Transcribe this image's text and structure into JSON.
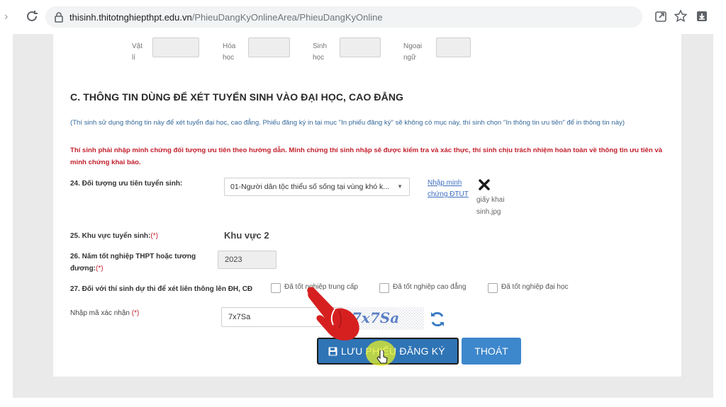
{
  "browser": {
    "url_host": "thisinh.thitotnghiepthpt.edu.vn",
    "url_path": "/PhieuDangKyOnlineArea/PhieuDangKyOnline"
  },
  "scores_row": {
    "subjects": [
      {
        "line1": "Vật",
        "line2": "lí"
      },
      {
        "line1": "Hóa",
        "line2": "học"
      },
      {
        "line1": "Sinh",
        "line2": "học"
      },
      {
        "line1": "Ngoại",
        "line2": "ngữ"
      }
    ]
  },
  "section_c": {
    "title": "C. THÔNG TIN DÙNG ĐỂ XÉT TUYỂN SINH VÀO ĐẠI HỌC, CAO ĐẲNG",
    "note_info": "(Thí sinh sử dụng thông tin này để xét tuyển đại học, cao đẳng. Phiếu đăng ký in tại mục \"In phiếu đăng ký\" sẽ không có mục này, thí sinh chọn \"In thông tin ưu tiên\" để in thông tin này)",
    "note_warning": "Thí sinh phải nhập minh chứng đối tượng ưu tiên theo hướng dẫn. Minh chứng thí sinh nhập sẽ được kiểm tra và xác thực, thí sinh chịu trách nhiệm hoàn toàn về thông tin ưu tiên và minh chứng khai báo."
  },
  "field24": {
    "label": "24. Đối tượng ưu tiên tuyển sinh:",
    "selected": "01-Người dân tộc thiểu số sống tại vùng khó k...",
    "evidence_link": "Nhập minh chứng ĐTUT",
    "file_name": "giấy khai sinh.jpg"
  },
  "field25": {
    "label": "25. Khu vực tuyển sinh:",
    "required_mark": "(*)",
    "value": "Khu vực 2"
  },
  "field26": {
    "label": "26. Năm tốt nghiệp THPT hoặc tương đương:",
    "required_mark": "(*)",
    "value": "2023"
  },
  "field27": {
    "label": "27. Đối với thí sinh dự thi để xét liên thông lên ĐH, CĐ",
    "options": [
      "Đã tốt nghiệp trung cấp",
      "Đã tốt nghiệp cao đẳng",
      "Đã tốt nghiệp đại học"
    ]
  },
  "captcha": {
    "label": "Nhập mã xác nhận",
    "required_mark": "(*)",
    "value": "7x7Sa",
    "image_text": "7x7Sa"
  },
  "actions": {
    "save_label": "LƯU PHIẾU ĐĂNG KÝ",
    "exit_label": "THOÁT"
  },
  "colors": {
    "primary_button": "#2f74b5",
    "secondary_button": "#3d87cc",
    "warning_text": "#c21f2c",
    "info_text": "#35689a"
  }
}
